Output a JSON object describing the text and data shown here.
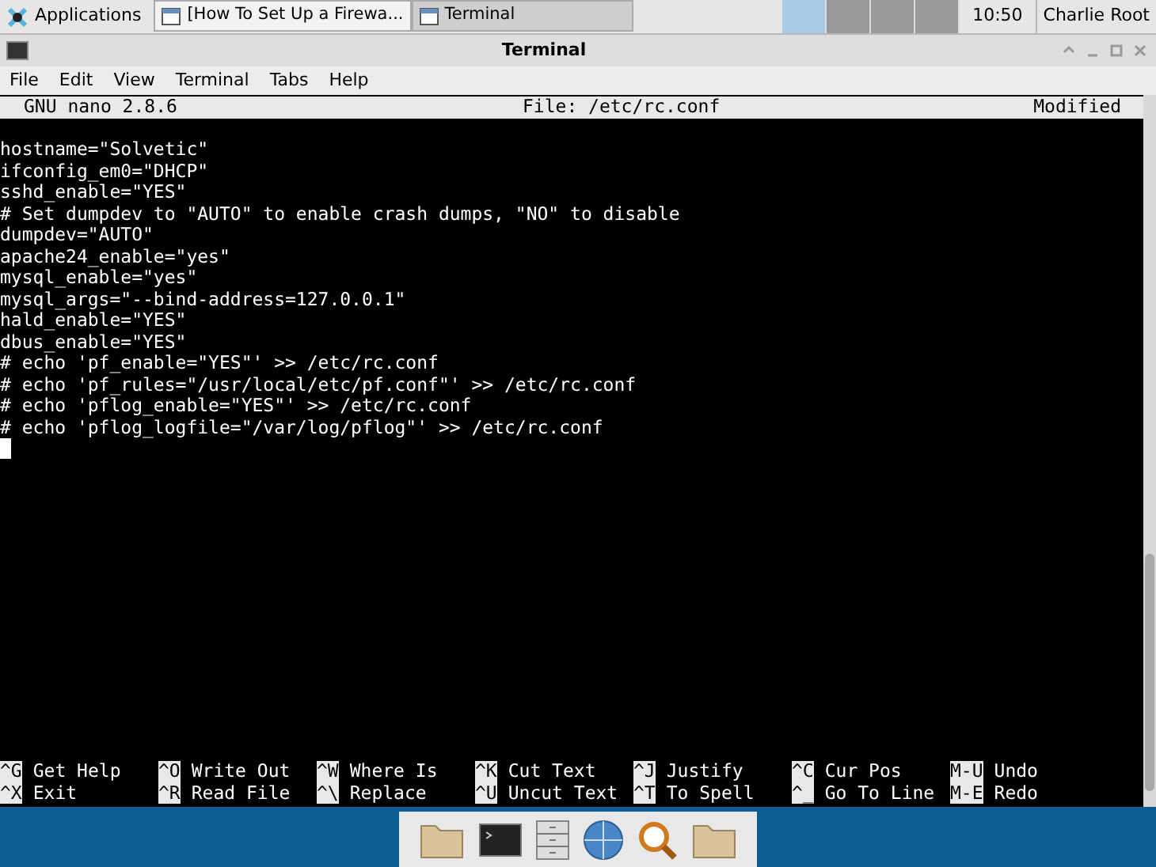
{
  "taskbar": {
    "applications": "Applications",
    "windows": [
      {
        "title": "[How To Set Up a Firewa...",
        "selected": false
      },
      {
        "title": "Terminal",
        "selected": true
      }
    ],
    "workspaces": [
      {
        "selected": true
      },
      {
        "selected": false
      },
      {
        "selected": false
      },
      {
        "selected": false
      }
    ],
    "clock": "10:50",
    "user": "Charlie Root"
  },
  "window": {
    "title": "Terminal",
    "menu": [
      "File",
      "Edit",
      "View",
      "Terminal",
      "Tabs",
      "Help"
    ]
  },
  "nano": {
    "version": "GNU nano 2.8.6",
    "file": "File: /etc/rc.conf",
    "status": "Modified",
    "lines": [
      "hostname=\"Solvetic\"",
      "ifconfig_em0=\"DHCP\"",
      "sshd_enable=\"YES\"",
      "# Set dumpdev to \"AUTO\" to enable crash dumps, \"NO\" to disable",
      "dumpdev=\"AUTO\"",
      "apache24_enable=\"yes\"",
      "mysql_enable=\"yes\"",
      "mysql_args=\"--bind-address=127.0.0.1\"",
      "hald_enable=\"YES\"",
      "dbus_enable=\"YES\"",
      "# echo 'pf_enable=\"YES\"' >> /etc/rc.conf",
      "# echo 'pf_rules=\"/usr/local/etc/pf.conf\"' >> /etc/rc.conf",
      "# echo 'pflog_enable=\"YES\"' >> /etc/rc.conf",
      "# echo 'pflog_logfile=\"/var/log/pflog\"' >> /etc/rc.conf"
    ],
    "shortcuts": [
      {
        "top": {
          "key": "^G",
          "label": "Get Help"
        },
        "bottom": {
          "key": "^X",
          "label": "Exit"
        }
      },
      {
        "top": {
          "key": "^O",
          "label": "Write Out"
        },
        "bottom": {
          "key": "^R",
          "label": "Read File"
        }
      },
      {
        "top": {
          "key": "^W",
          "label": "Where Is"
        },
        "bottom": {
          "key": "^\\",
          "label": "Replace"
        }
      },
      {
        "top": {
          "key": "^K",
          "label": "Cut Text"
        },
        "bottom": {
          "key": "^U",
          "label": "Uncut Text"
        }
      },
      {
        "top": {
          "key": "^J",
          "label": "Justify"
        },
        "bottom": {
          "key": "^T",
          "label": "To Spell"
        }
      },
      {
        "top": {
          "key": "^C",
          "label": "Cur Pos"
        },
        "bottom": {
          "key": "^_",
          "label": "Go To Line"
        }
      },
      {
        "top": {
          "key": "M-U",
          "label": "Undo"
        },
        "bottom": {
          "key": "M-E",
          "label": "Redo"
        }
      }
    ]
  }
}
